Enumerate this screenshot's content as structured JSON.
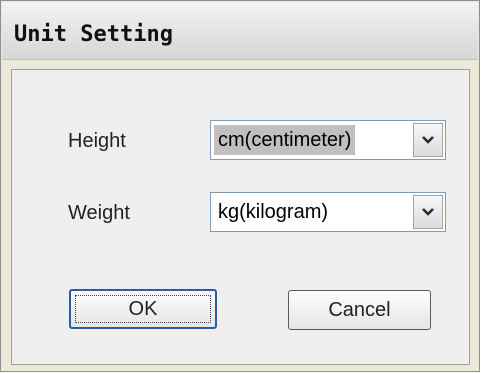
{
  "dialog": {
    "title": "Unit Setting",
    "height_label": "Height",
    "height_value": "cm(centimeter)",
    "weight_label": "Weight",
    "weight_value": "kg(kilogram)",
    "ok_label": "OK",
    "cancel_label": "Cancel"
  },
  "icons": {
    "dropdown": "chevron-down-icon"
  }
}
